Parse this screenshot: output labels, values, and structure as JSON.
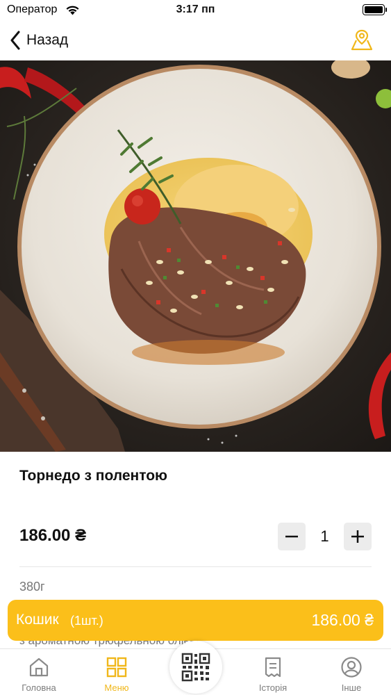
{
  "status_bar": {
    "carrier": "Оператор",
    "time": "3:17 пп"
  },
  "nav": {
    "back_label": "Назад"
  },
  "product": {
    "title": "Торнедо з полентою",
    "price": "186.00 ₴",
    "quantity": "1",
    "weight": "380г",
    "description_fragment": "з ароматною трюфельною олією"
  },
  "cart": {
    "label": "Кошик",
    "count": "(1шт.)",
    "total": "186.00 ₴"
  },
  "tabs": [
    {
      "label": "Головна",
      "icon": "home-icon"
    },
    {
      "label": "Меню",
      "icon": "menu-grid-icon",
      "active": true
    },
    {
      "label": "",
      "icon": "qr-code-icon"
    },
    {
      "label": "Історія",
      "icon": "receipt-icon"
    },
    {
      "label": "Інше",
      "icon": "profile-icon"
    }
  ],
  "colors": {
    "accent": "#fbbf1a",
    "tab_active": "#f0b71a",
    "tab_inactive": "#7c7c7c"
  }
}
